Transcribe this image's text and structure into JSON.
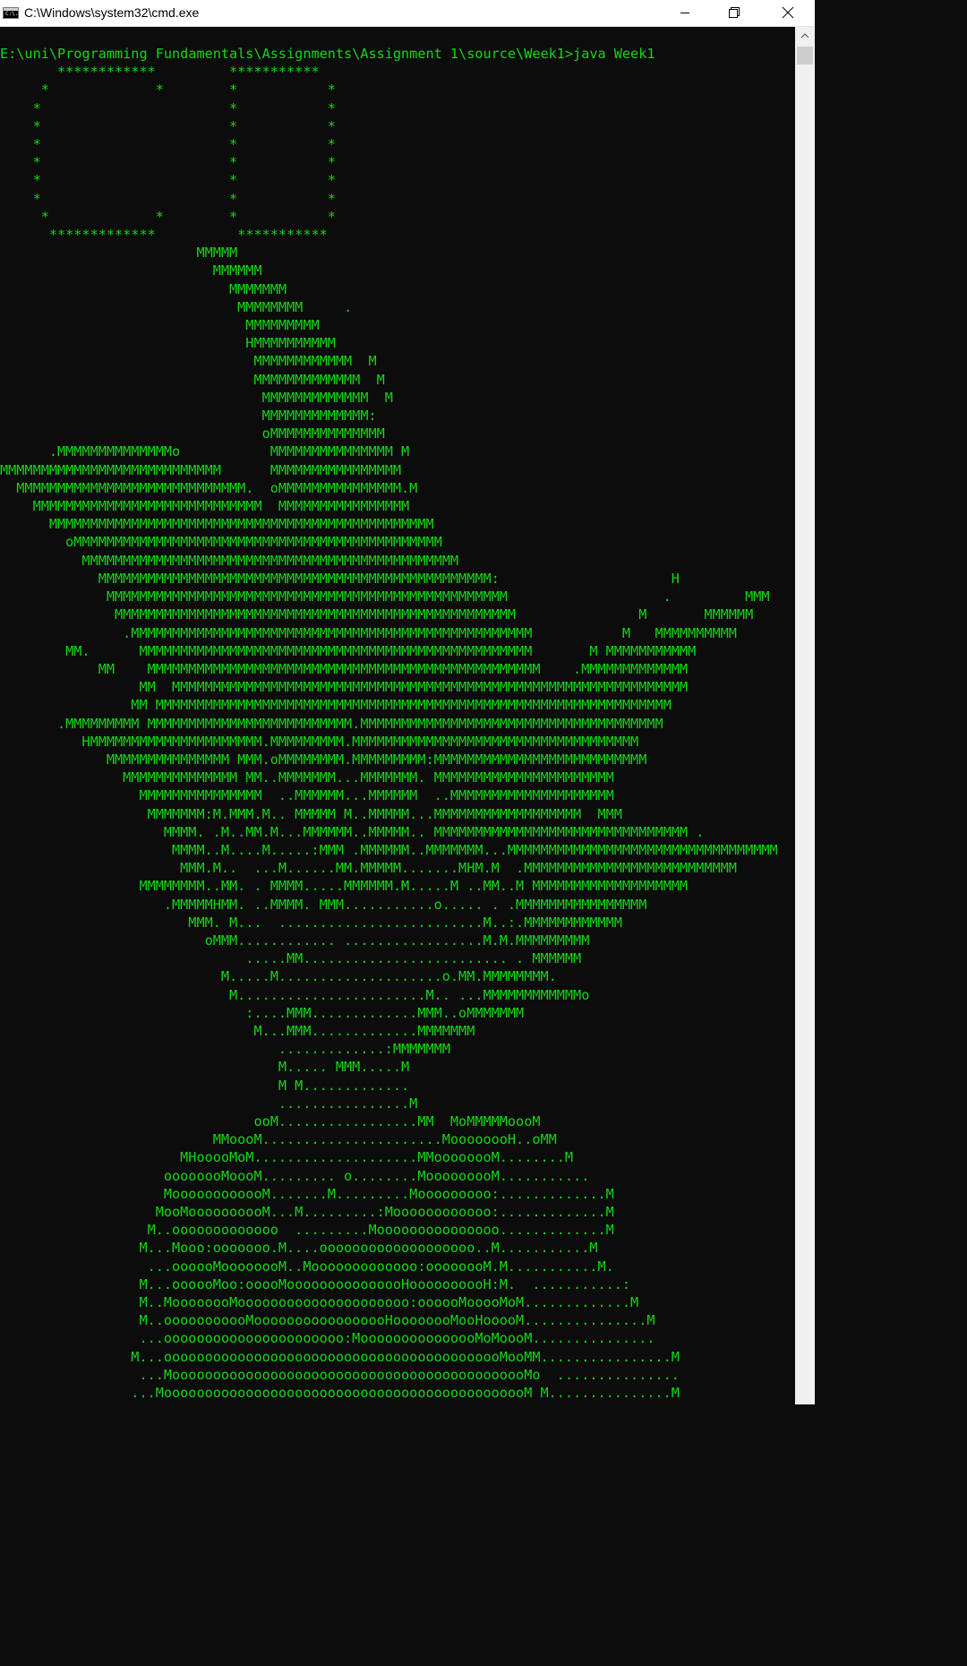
{
  "window": {
    "title": "C:\\Windows\\system32\\cmd.exe",
    "icon_label": "C:\\."
  },
  "colors": {
    "console_background": "#0c0c0c",
    "console_text": "#13d813",
    "titlebar_background": "#ffffff"
  },
  "icons": {
    "app": "console-app-icon",
    "minimize": "minimize-icon",
    "maximize": "restore-icon",
    "close": "close-icon"
  },
  "console": {
    "lines": [
      "E:\\uni\\Programming Fundamentals\\Assignments\\Assignment 1\\source\\Week1>java Week1",
      "       ************         ***********",
      "     *             *        *           *",
      "    *                       *           *",
      "    *                       *           *",
      "    *                       *           *",
      "    *                       *           *",
      "    *                       *           *",
      "    *                       *           *",
      "     *             *        *           *",
      "      *************          ***********",
      "                        MMMMM",
      "                          MMMMMM",
      "                            MMMMMMM",
      "                             MMMMMMMM     .",
      "                              MMMMMMMMM",
      "                              HMMMMMMMMMM",
      "                               MMMMMMMMMMMM  M",
      "                               MMMMMMMMMMMMM  M",
      "                                MMMMMMMMMMMMM  M",
      "                                MMMMMMMMMMMMM:",
      "                                oMMMMMMMMMMMMMM",
      "      .MMMMMMMMMMMMMMo           MMMMMMMMMMMMMMM M",
      "MMMMMMMMMMMMMMMMMMMMMMMMMMM      MMMMMMMMMMMMMMMM",
      "  MMMMMMMMMMMMMMMMMMMMMMMMMMMM.  oMMMMMMMMMMMMMMM.M",
      "    MMMMMMMMMMMMMMMMMMMMMMMMMMMM  MMMMMMMMMMMMMMMM",
      "      MMMMMMMMMMMMMMMMMMMMMMMMMMMMMMMMMMMMMMMMMMMMMMM",
      "        oMMMMMMMMMMMMMMMMMMMMMMMMMMMMMMMMMMMMMMMMMMMMM",
      "          MMMMMMMMMMMMMMMMMMMMMMMMMMMMMMMMMMMMMMMMMMMMMM",
      "            MMMMMMMMMMMMMMMMMMMMMMMMMMMMMMMMMMMMMMMMMMMMMMMM:                     H",
      "             MMMMMMMMMMMMMMMMMMMMMMMMMMMMMMMMMMMMMMMMMMMMMMMMM                   .         MMM",
      "              MMMMMMMMMMMMMMMMMMMMMMMMMMMMMMMMMMMMMMMMMMMMMMMMM               M       MMMMMM",
      "               .MMMMMMMMMMMMMMMMMMMMMMMMMMMMMMMMMMMMMMMMMMMMMMMMM           M   MMMMMMMMMM",
      "        MM.      MMMMMMMMMMMMMMMMMMMMMMMMMMMMMMMMMMMMMMMMMMMMMMMM       M MMMMMMMMMMM",
      "            MM    MMMMMMMMMMMMMMMMMMMMMMMMMMMMMMMMMMMMMMMMMMMMMMMM    .MMMMMMMMMMMMM",
      "                 MM  MMMMMMMMMMMMMMMMMMMMMMMMMMMMMMMMMMMMMMMMMMMMMMMMMMMMMMMMMMMMMMM",
      "                MM MMMMMMMMMMMMMMMMMMMMMMMMMMMMMMMMMMMMMMMMMMMMMMMMMMMMMMMMMMMMMMM",
      "       .MMMMMMMMM MMMMMMMMMMMMMMMMMMMMMMMMM.MMMMMMMMMMMMMMMMMMMMMMMMMMMMMMMMMMMMM",
      "          HMMMMMMMMMMMMMMMMMMMMM.MMMMMMMMM.MMMMMMMMMMMMMMMMMMMMMMMMMMMMMMMMMMM",
      "             MMMMMMMMMMMMMMM MMM.oMMMMMMMM.MMMMMMMMM:MMMMMMMMMMMMMMMMMMMMMMMMMM",
      "               MMMMMMMMMMMMMM MM..MMMMMMM...MMMMMMM. MMMMMMMMMMMMMMMMMMMMMM",
      "                 MMMMMMMMMMMMMMM  ..MMMMMM...MMMMMM  ..MMMMMMMMMMMMMMMMMMMM",
      "                  MMMMMMM:M.MMM.M.. MMMMM M..MMMMM...MMMMMMMMMMMMMMMMMM  MMM",
      "                    MMMM. .M..MM.M...MMMMMM..MMMMM.. MMMMMMMMMMMMMMMMMMMMMMMMMMMMMMM .",
      "                     MMMM..M....M.....:MMM .MMMMMM..MMMMMMM...MMMMMMMMMMMMMMMMMMMMMMMMMMMMMMMMM",
      "                      MMM.M..  ...M......MM.MMMMM.......MHM.M  .MMMMMMMMMMMMMMMMMMMMMMMMMM",
      "                 MMMMMMMM..MM. . MMMM.....MMMMMM.M.....M ..MM..M MMMMMMMMMMMMMMMMMMM",
      "                    .MMMMMHMM. ..MMMM. MMM...........o..... . .MMMMMMMMMMMMMMMM",
      "                       MMM. M...  .........................M..:.MMMMMMMMMMMM",
      "                         oMMM............ .................M.M.MMMMMMMMM",
      "                              .....MM......................... . MMMMMM",
      "                           M.....M....................o.MM.MMMMMMMM.",
      "                            M.......................M.. ...MMMMMMMMMMMMo",
      "                              :....MMM.............MMM..oMMMMMMM",
      "                               M...MMM.............MMMMMMM",
      "                                  .............:MMMMMMM",
      "                                  M..... MMM.....M",
      "                                  M M.............",
      "                                  ................M",
      "                               ooM.................MM  MoMMMMMoooM",
      "                          MMoooM......................MoooooooH..oMM",
      "                      MHooooMoM....................MMoooooooM........M",
      "                    oooooooMoooM......... o........MooooooooM...........",
      "                    MoooooooooooM.......M.........Mooooooooo:.............M",
      "                   MooMoooooooooM...M.........:Moooooooooooo:.............M",
      "                  M..ooooooooooooo  .........Mooooooooooooooo.............M",
      "                 M...Mooo:ooooooo.M....ooooooooooooooooooo..M...........M",
      "                  ...oooooMoooooooM..Mooooooooooooo:oooooooM.M...........M.",
      "                 M...oooooMoo:ooooMooooooooooooooHoooooooooH:M.  ...........:",
      "                 M..MoooooooMooooooooooooooooooooo:oooooMooooMoM.............M",
      "                 M..ooooooooooMooooooooooooooooHoooooooMooHooooM...............M",
      "                 ...oooooooooooooooooooooo:MooooooooooooooMoMoooM...............",
      "                M...oooooooooooooooooooooooooooooooooooooooooMooMM................M",
      "                 ...MoooooooooooooooooooooooooooooooooooooooooooMo  ...............",
      "                ...MooooooooooooooooooooooooooooooooooooooooooooM M...............M"
    ]
  }
}
